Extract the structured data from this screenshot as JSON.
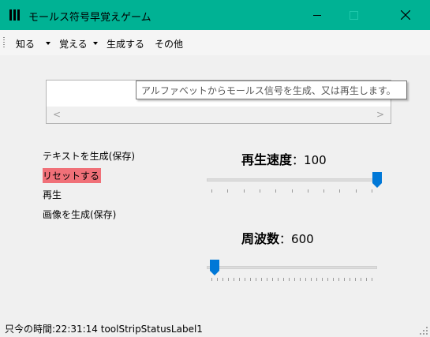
{
  "window": {
    "title": "モールス符号早覚えゲーム",
    "accent": "#00b294"
  },
  "menu": {
    "items": [
      {
        "label": "知る",
        "has_dropdown": true
      },
      {
        "label": "覚える",
        "has_dropdown": true
      },
      {
        "label": "生成する",
        "has_dropdown": false
      },
      {
        "label": "その他",
        "has_dropdown": false
      }
    ]
  },
  "text_input": {
    "value": "",
    "scroll_left_icon": "chevron-left-icon",
    "scroll_right_icon": "chevron-right-icon"
  },
  "tooltip": {
    "text": "アルファベットからモールス信号を生成、又は再生します。"
  },
  "options": {
    "items": [
      {
        "label": "テキストを生成(保存)",
        "highlighted": false
      },
      {
        "label": "リセットする",
        "highlighted": true
      },
      {
        "label": "再生",
        "highlighted": false
      },
      {
        "label": "画像を生成(保存)",
        "highlighted": false
      }
    ],
    "highlight_color": "#f07078"
  },
  "speed": {
    "label": "再生速度",
    "separator": "：",
    "value": "100",
    "slider_fraction": 1.0,
    "tick_count": 11
  },
  "frequency": {
    "label": "周波数",
    "separator": "：",
    "value": "600",
    "slider_fraction": 0.0,
    "tick_count": 30
  },
  "slider_color": "#0078d7",
  "status": {
    "label": "只今の時間:22:31:14  toolStripStatusLabel1"
  }
}
